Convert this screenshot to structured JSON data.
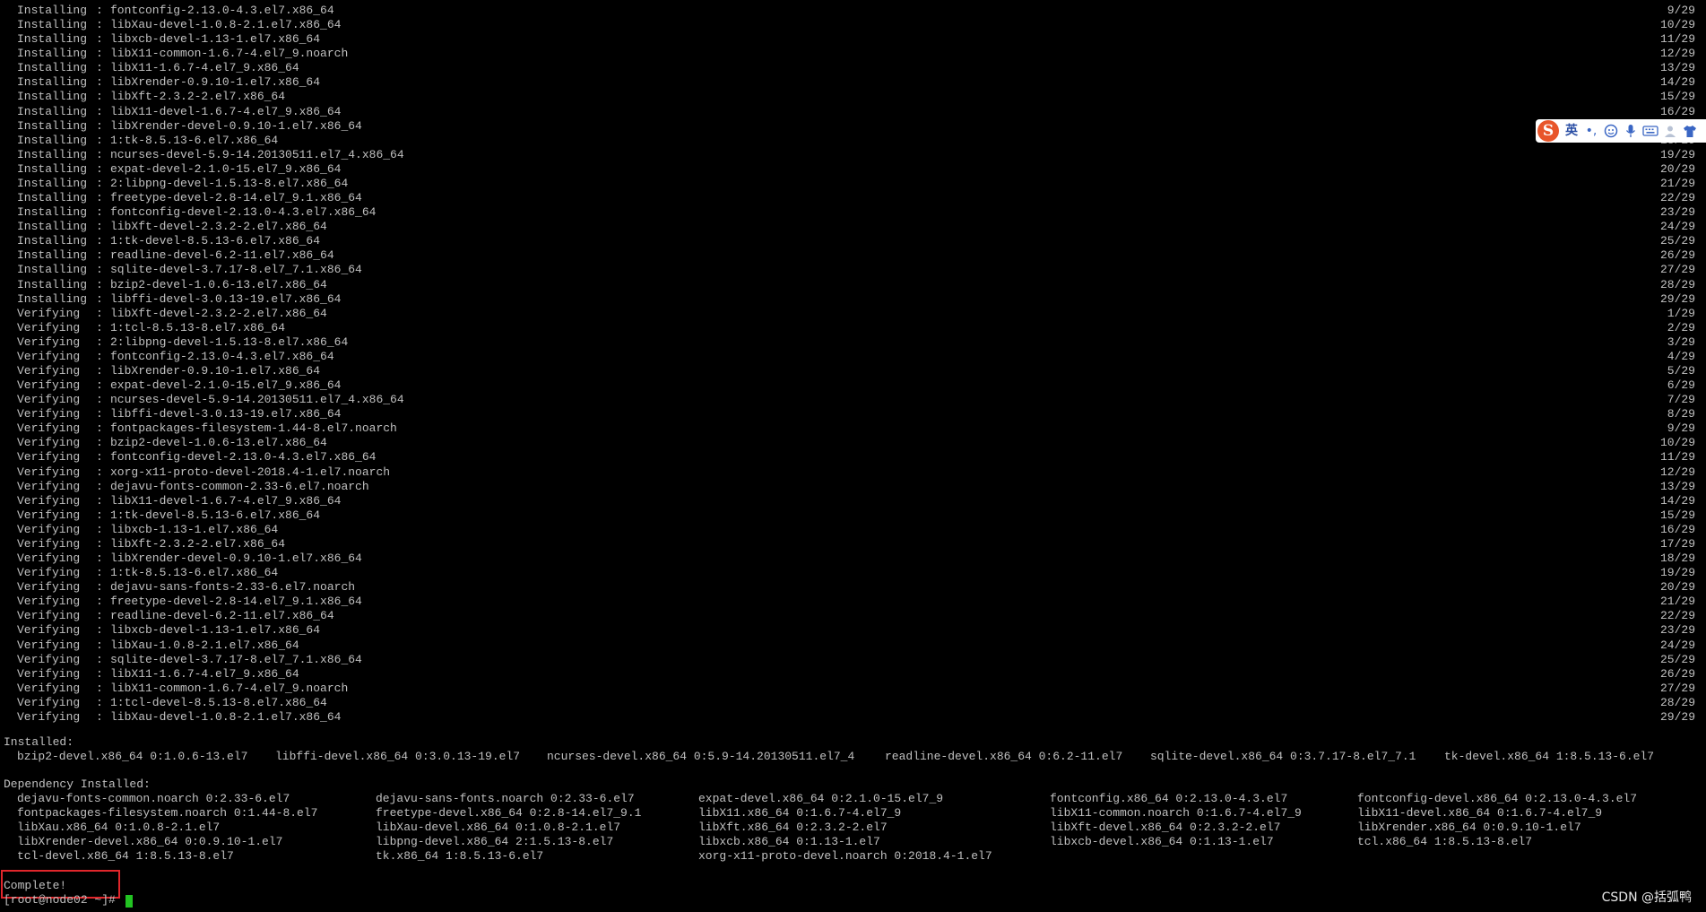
{
  "terminal": {
    "transaction_lines": [
      {
        "action": "Installing",
        "package": "fontconfig-2.13.0-4.3.el7.x86_64",
        "progress": "9/29"
      },
      {
        "action": "Installing",
        "package": "libXau-devel-1.0.8-2.1.el7.x86_64",
        "progress": "10/29"
      },
      {
        "action": "Installing",
        "package": "libxcb-devel-1.13-1.el7.x86_64",
        "progress": "11/29"
      },
      {
        "action": "Installing",
        "package": "libX11-common-1.6.7-4.el7_9.noarch",
        "progress": "12/29"
      },
      {
        "action": "Installing",
        "package": "libX11-1.6.7-4.el7_9.x86_64",
        "progress": "13/29"
      },
      {
        "action": "Installing",
        "package": "libXrender-0.9.10-1.el7.x86_64",
        "progress": "14/29"
      },
      {
        "action": "Installing",
        "package": "libXft-2.3.2-2.el7.x86_64",
        "progress": "15/29"
      },
      {
        "action": "Installing",
        "package": "libX11-devel-1.6.7-4.el7_9.x86_64",
        "progress": "16/29"
      },
      {
        "action": "Installing",
        "package": "libXrender-devel-0.9.10-1.el7.x86_64",
        "progress": "17/29"
      },
      {
        "action": "Installing",
        "package": "1:tk-8.5.13-6.el7.x86_64",
        "progress": "18/29"
      },
      {
        "action": "Installing",
        "package": "ncurses-devel-5.9-14.20130511.el7_4.x86_64",
        "progress": "19/29"
      },
      {
        "action": "Installing",
        "package": "expat-devel-2.1.0-15.el7_9.x86_64",
        "progress": "20/29"
      },
      {
        "action": "Installing",
        "package": "2:libpng-devel-1.5.13-8.el7.x86_64",
        "progress": "21/29"
      },
      {
        "action": "Installing",
        "package": "freetype-devel-2.8-14.el7_9.1.x86_64",
        "progress": "22/29"
      },
      {
        "action": "Installing",
        "package": "fontconfig-devel-2.13.0-4.3.el7.x86_64",
        "progress": "23/29"
      },
      {
        "action": "Installing",
        "package": "libXft-devel-2.3.2-2.el7.x86_64",
        "progress": "24/29"
      },
      {
        "action": "Installing",
        "package": "1:tk-devel-8.5.13-6.el7.x86_64",
        "progress": "25/29"
      },
      {
        "action": "Installing",
        "package": "readline-devel-6.2-11.el7.x86_64",
        "progress": "26/29"
      },
      {
        "action": "Installing",
        "package": "sqlite-devel-3.7.17-8.el7_7.1.x86_64",
        "progress": "27/29"
      },
      {
        "action": "Installing",
        "package": "bzip2-devel-1.0.6-13.el7.x86_64",
        "progress": "28/29"
      },
      {
        "action": "Installing",
        "package": "libffi-devel-3.0.13-19.el7.x86_64",
        "progress": "29/29"
      },
      {
        "action": "Verifying",
        "package": "libXft-devel-2.3.2-2.el7.x86_64",
        "progress": "1/29"
      },
      {
        "action": "Verifying",
        "package": "1:tcl-8.5.13-8.el7.x86_64",
        "progress": "2/29"
      },
      {
        "action": "Verifying",
        "package": "2:libpng-devel-1.5.13-8.el7.x86_64",
        "progress": "3/29"
      },
      {
        "action": "Verifying",
        "package": "fontconfig-2.13.0-4.3.el7.x86_64",
        "progress": "4/29"
      },
      {
        "action": "Verifying",
        "package": "libXrender-0.9.10-1.el7.x86_64",
        "progress": "5/29"
      },
      {
        "action": "Verifying",
        "package": "expat-devel-2.1.0-15.el7_9.x86_64",
        "progress": "6/29"
      },
      {
        "action": "Verifying",
        "package": "ncurses-devel-5.9-14.20130511.el7_4.x86_64",
        "progress": "7/29"
      },
      {
        "action": "Verifying",
        "package": "libffi-devel-3.0.13-19.el7.x86_64",
        "progress": "8/29"
      },
      {
        "action": "Verifying",
        "package": "fontpackages-filesystem-1.44-8.el7.noarch",
        "progress": "9/29"
      },
      {
        "action": "Verifying",
        "package": "bzip2-devel-1.0.6-13.el7.x86_64",
        "progress": "10/29"
      },
      {
        "action": "Verifying",
        "package": "fontconfig-devel-2.13.0-4.3.el7.x86_64",
        "progress": "11/29"
      },
      {
        "action": "Verifying",
        "package": "xorg-x11-proto-devel-2018.4-1.el7.noarch",
        "progress": "12/29"
      },
      {
        "action": "Verifying",
        "package": "dejavu-fonts-common-2.33-6.el7.noarch",
        "progress": "13/29"
      },
      {
        "action": "Verifying",
        "package": "libX11-devel-1.6.7-4.el7_9.x86_64",
        "progress": "14/29"
      },
      {
        "action": "Verifying",
        "package": "1:tk-devel-8.5.13-6.el7.x86_64",
        "progress": "15/29"
      },
      {
        "action": "Verifying",
        "package": "libxcb-1.13-1.el7.x86_64",
        "progress": "16/29"
      },
      {
        "action": "Verifying",
        "package": "libXft-2.3.2-2.el7.x86_64",
        "progress": "17/29"
      },
      {
        "action": "Verifying",
        "package": "libXrender-devel-0.9.10-1.el7.x86_64",
        "progress": "18/29"
      },
      {
        "action": "Verifying",
        "package": "1:tk-8.5.13-6.el7.x86_64",
        "progress": "19/29"
      },
      {
        "action": "Verifying",
        "package": "dejavu-sans-fonts-2.33-6.el7.noarch",
        "progress": "20/29"
      },
      {
        "action": "Verifying",
        "package": "freetype-devel-2.8-14.el7_9.1.x86_64",
        "progress": "21/29"
      },
      {
        "action": "Verifying",
        "package": "readline-devel-6.2-11.el7.x86_64",
        "progress": "22/29"
      },
      {
        "action": "Verifying",
        "package": "libxcb-devel-1.13-1.el7.x86_64",
        "progress": "23/29"
      },
      {
        "action": "Verifying",
        "package": "libXau-1.0.8-2.1.el7.x86_64",
        "progress": "24/29"
      },
      {
        "action": "Verifying",
        "package": "sqlite-devel-3.7.17-8.el7_7.1.x86_64",
        "progress": "25/29"
      },
      {
        "action": "Verifying",
        "package": "libX11-1.6.7-4.el7_9.x86_64",
        "progress": "26/29"
      },
      {
        "action": "Verifying",
        "package": "libX11-common-1.6.7-4.el7_9.noarch",
        "progress": "27/29"
      },
      {
        "action": "Verifying",
        "package": "1:tcl-devel-8.5.13-8.el7.x86_64",
        "progress": "28/29"
      },
      {
        "action": "Verifying",
        "package": "libXau-devel-1.0.8-2.1.el7.x86_64",
        "progress": "29/29"
      }
    ],
    "installed_header": "Installed:",
    "installed": [
      "bzip2-devel.x86_64 0:1.0.6-13.el7",
      "libffi-devel.x86_64 0:3.0.13-19.el7",
      "ncurses-devel.x86_64 0:5.9-14.20130511.el7_4",
      "readline-devel.x86_64 0:6.2-11.el7",
      "sqlite-devel.x86_64 0:3.7.17-8.el7_7.1",
      "tk-devel.x86_64 1:8.5.13-6.el7"
    ],
    "dependency_header": "Dependency Installed:",
    "dependencies": [
      [
        "dejavu-fonts-common.noarch 0:2.33-6.el7",
        "dejavu-sans-fonts.noarch 0:2.33-6.el7",
        "expat-devel.x86_64 0:2.1.0-15.el7_9",
        "fontconfig.x86_64 0:2.13.0-4.3.el7",
        "fontconfig-devel.x86_64 0:2.13.0-4.3.el7"
      ],
      [
        "fontpackages-filesystem.noarch 0:1.44-8.el7",
        "freetype-devel.x86_64 0:2.8-14.el7_9.1",
        "libX11.x86_64 0:1.6.7-4.el7_9",
        "libX11-common.noarch 0:1.6.7-4.el7_9",
        "libX11-devel.x86_64 0:1.6.7-4.el7_9"
      ],
      [
        "libXau.x86_64 0:1.0.8-2.1.el7",
        "libXau-devel.x86_64 0:1.0.8-2.1.el7",
        "libXft.x86_64 0:2.3.2-2.el7",
        "libXft-devel.x86_64 0:2.3.2-2.el7",
        "libXrender.x86_64 0:0.9.10-1.el7"
      ],
      [
        "libXrender-devel.x86_64 0:0.9.10-1.el7",
        "libpng-devel.x86_64 2:1.5.13-8.el7",
        "libxcb.x86_64 0:1.13-1.el7",
        "libxcb-devel.x86_64 0:1.13-1.el7",
        "tcl.x86_64 1:8.5.13-8.el7"
      ],
      [
        "tcl-devel.x86_64 1:8.5.13-8.el7",
        "tk.x86_64 1:8.5.13-6.el7",
        "xorg-x11-proto-devel.noarch 0:2018.4-1.el7"
      ]
    ],
    "complete_text": "Complete!",
    "prompt_text": "[root@node02 ~]# ",
    "cursor_color": "#22c322",
    "highlight_color": "#e0262b"
  },
  "ime_toolbar": {
    "logo_letter": "S",
    "language_label": "英",
    "punct_label": "•,",
    "icons": [
      "emoji-icon",
      "microphone-icon",
      "keyboard-icon",
      "user-icon",
      "skin-icon"
    ]
  },
  "watermark": "CSDN @括弧鸭"
}
